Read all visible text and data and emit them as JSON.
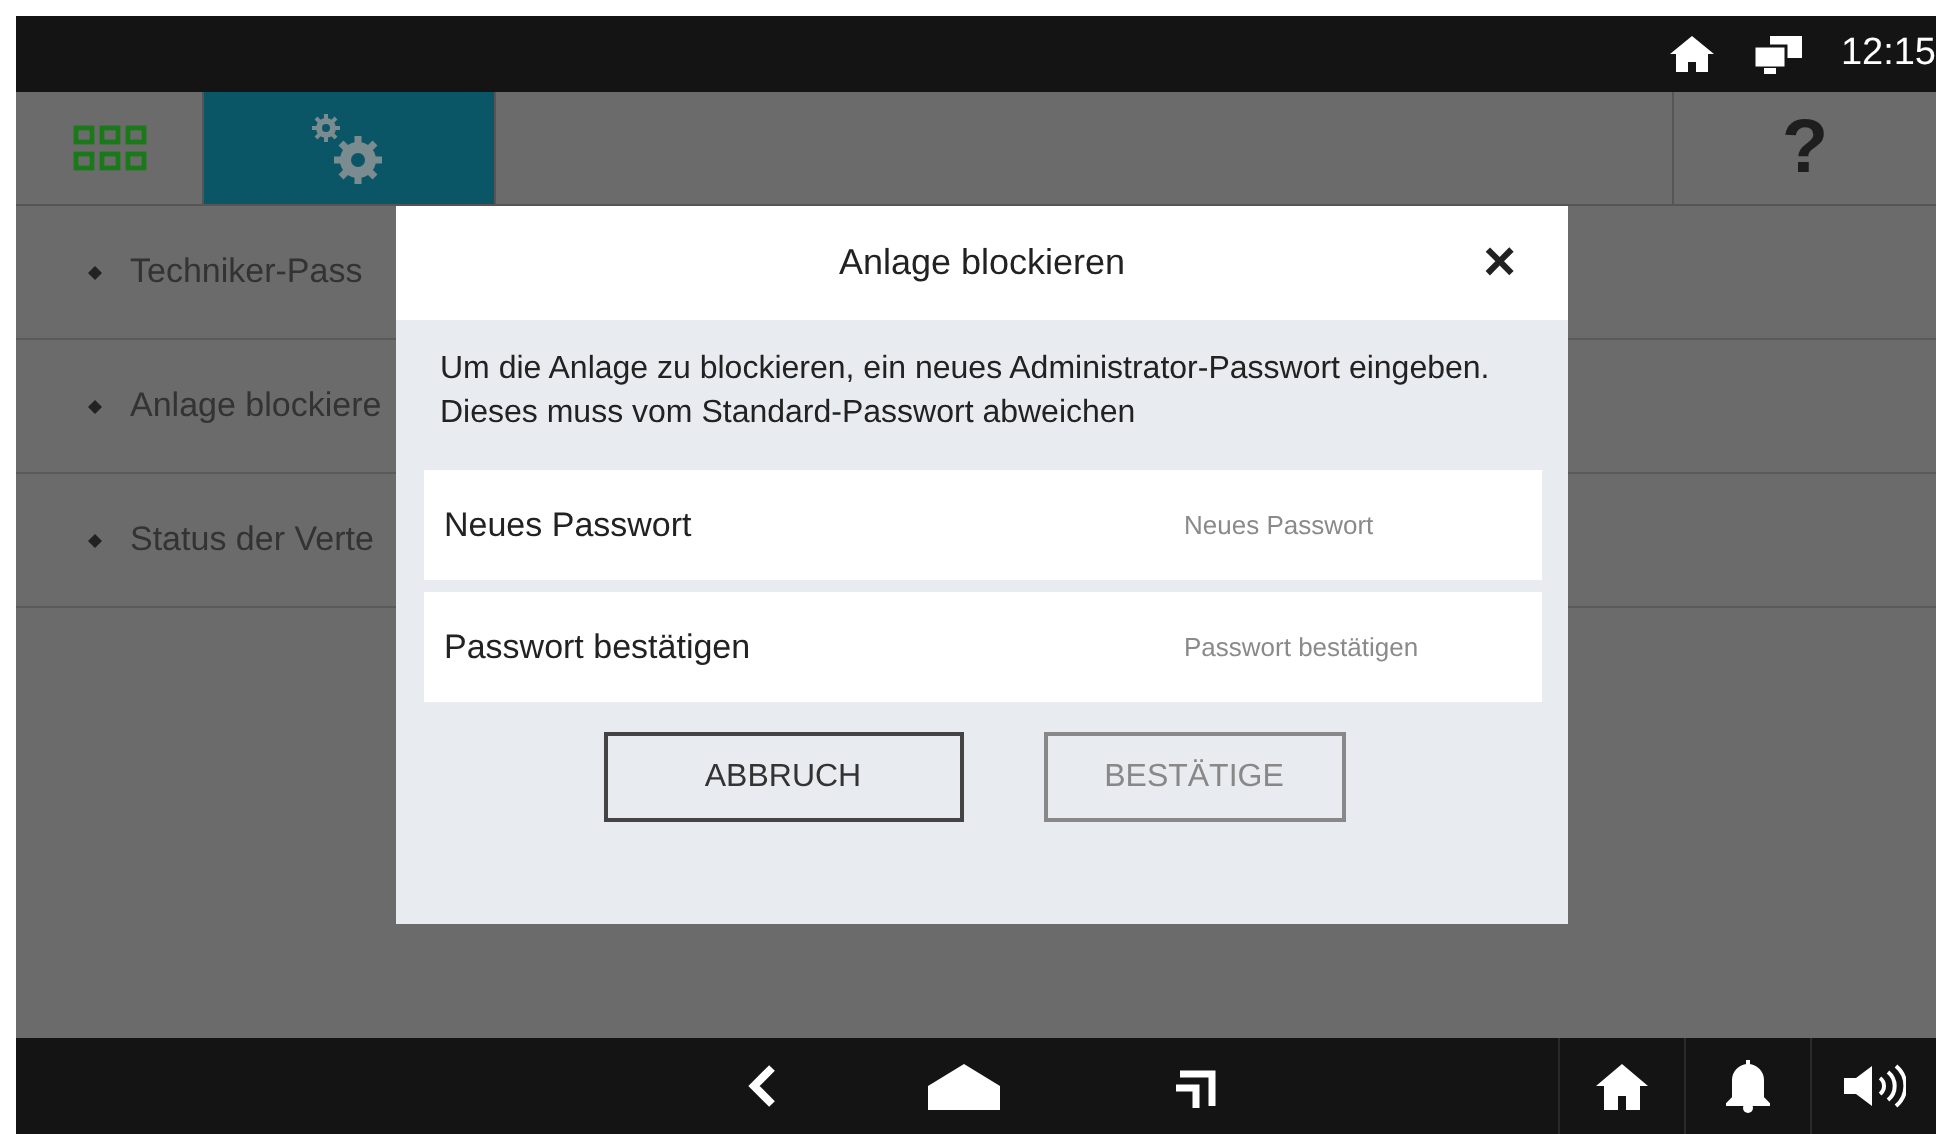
{
  "status_bar": {
    "time": "12:15"
  },
  "top_bar": {
    "tabs": [
      {
        "kind": "grid",
        "selected": false
      },
      {
        "kind": "settings",
        "selected": true
      }
    ],
    "help_label": "?"
  },
  "menu": {
    "items": [
      {
        "label": "Techniker-Pass"
      },
      {
        "label": "Anlage blockiere"
      },
      {
        "label": "Status der Verte"
      }
    ]
  },
  "dialog": {
    "title": "Anlage blockieren",
    "close_label": "×",
    "message": [
      "Um die Anlage zu blockieren, ein neues Administrator-Passwort eingeben.",
      "Dieses muss vom Standard-Passwort abweichen"
    ],
    "fields": [
      {
        "label": "Neues Passwort",
        "placeholder": "Neues Passwort"
      },
      {
        "label": "Passwort bestätigen",
        "placeholder": "Passwort bestätigen"
      }
    ],
    "buttons": [
      {
        "label": "ABBRUCH",
        "disabled": false
      },
      {
        "label": "BESTÄTIGE",
        "disabled": true
      }
    ]
  },
  "nav_bar": {
    "buttons": [
      {
        "kind": "back"
      },
      {
        "kind": "home"
      },
      {
        "kind": "recent"
      }
    ],
    "right": [
      {
        "kind": "house"
      },
      {
        "kind": "bell"
      },
      {
        "kind": "speaker"
      }
    ]
  }
}
